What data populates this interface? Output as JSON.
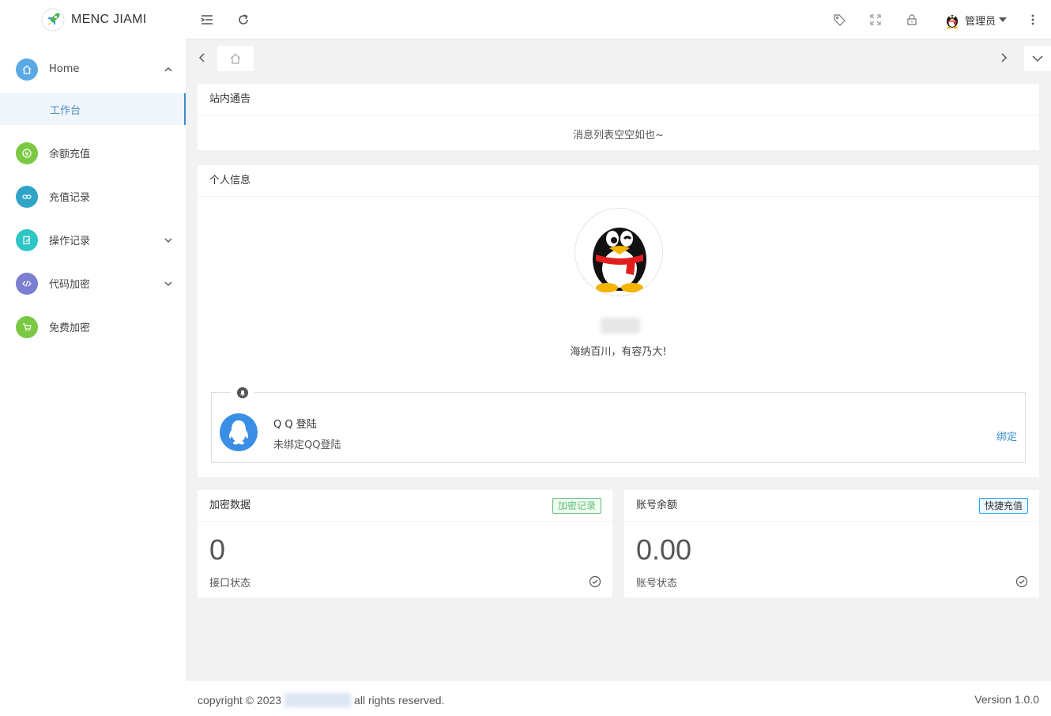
{
  "app": {
    "title": "MENC JIAMI"
  },
  "sidebar": {
    "items": [
      {
        "label": "Home",
        "icon": "home-icon",
        "color": "#5aa9e6",
        "expanded": true
      },
      {
        "label": "余额充值",
        "icon": "coin-icon",
        "color": "#7ac943"
      },
      {
        "label": "充值记录",
        "icon": "link-icon",
        "color": "#2fa4c7"
      },
      {
        "label": "操作记录",
        "icon": "edit-icon",
        "color": "#2ec5c5"
      },
      {
        "label": "代码加密",
        "icon": "code-icon",
        "color": "#7b7fd0"
      },
      {
        "label": "免费加密",
        "icon": "cart-icon",
        "color": "#7ac943"
      }
    ],
    "sub_items": [
      {
        "label": "工作台"
      }
    ]
  },
  "header": {
    "user_name": "管理员"
  },
  "notice": {
    "title": "站内通告",
    "empty_text": "消息列表空空如也~"
  },
  "profile": {
    "title": "个人信息",
    "motto": "海纳百川，有容乃大!",
    "qq": {
      "title": "Q Q 登陆",
      "status": "未绑定QQ登陆",
      "bind_label": "绑定"
    }
  },
  "stats": {
    "encrypt": {
      "title": "加密数据",
      "badge": "加密记录",
      "value": "0",
      "label": "接口状态"
    },
    "balance": {
      "title": "账号余额",
      "badge": "快捷充值",
      "value": "0.00",
      "label": "账号状态"
    }
  },
  "footer": {
    "copyright_prefix": "copyright © 2023",
    "copyright_suffix": "all rights reserved.",
    "version": "Version 1.0.0"
  },
  "colors": {
    "accent": "#3a8fc9",
    "green": "#5fb878",
    "blue": "#1e9fff",
    "qq_blue": "#3a8ee6"
  }
}
